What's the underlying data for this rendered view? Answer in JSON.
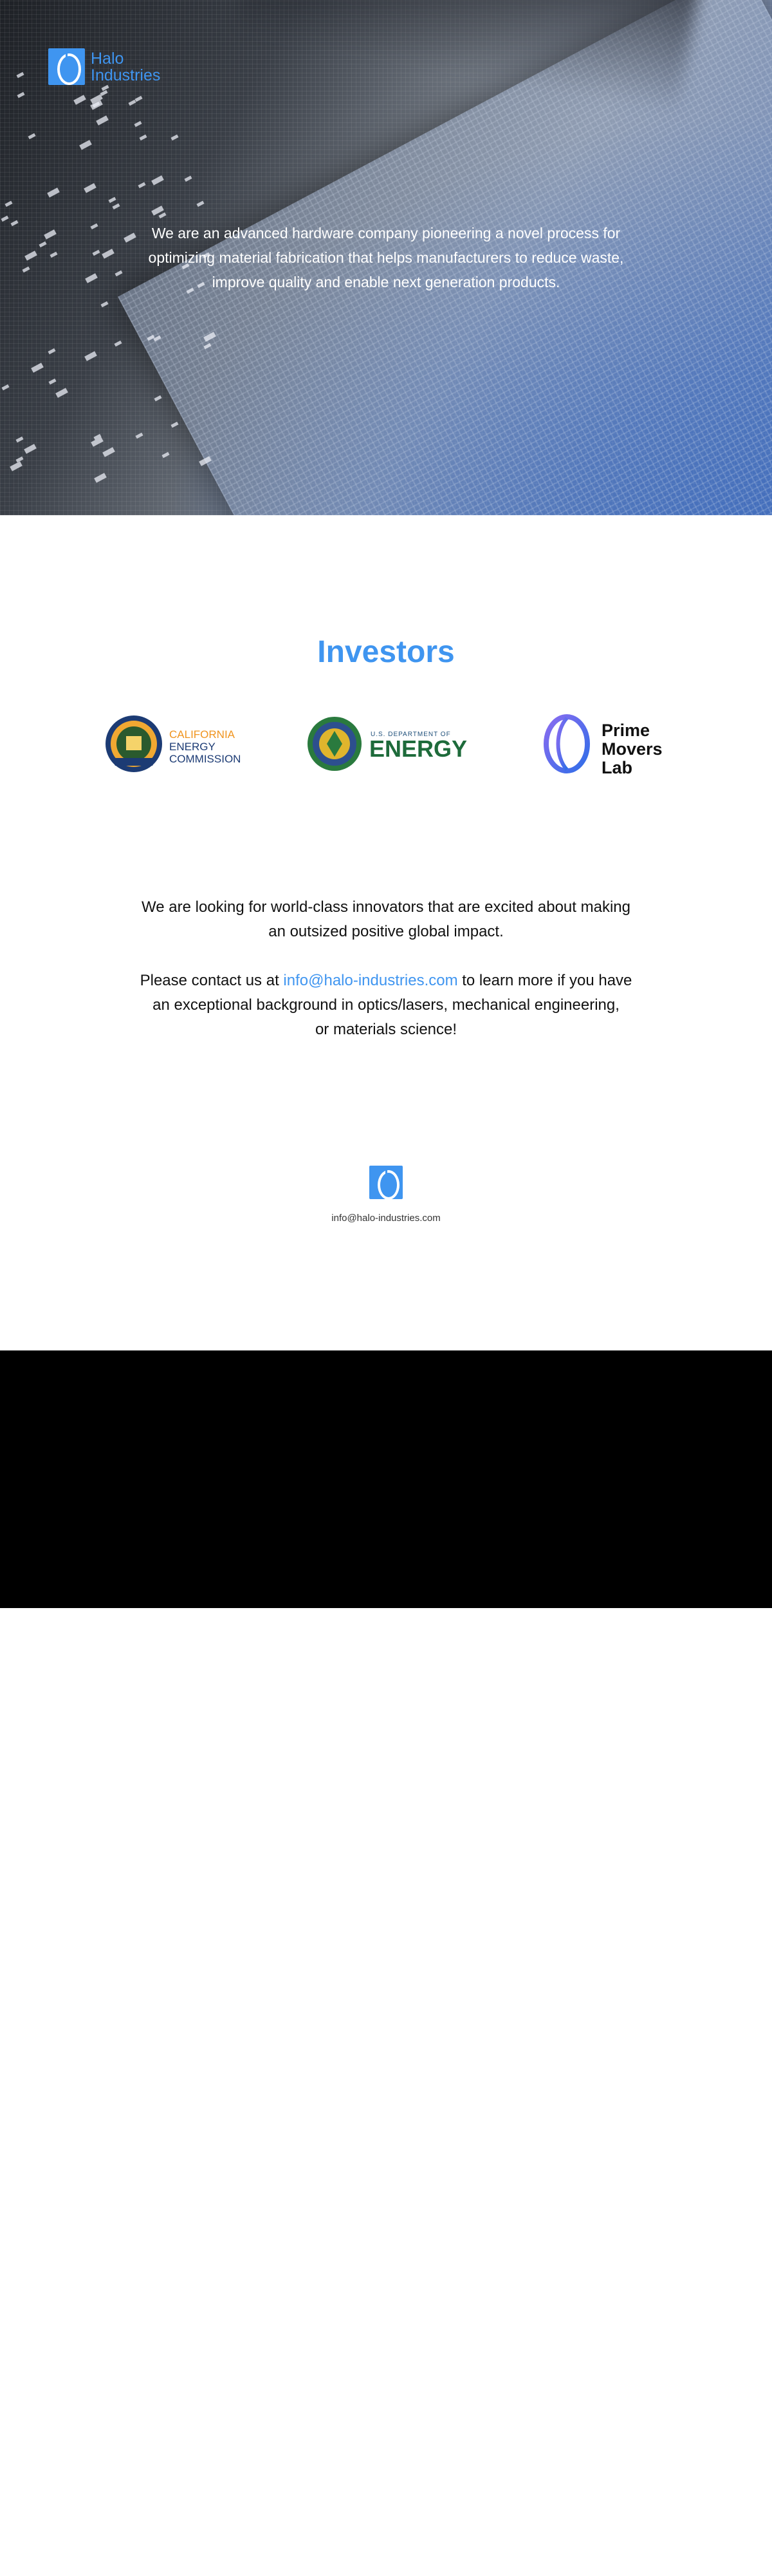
{
  "brand": {
    "name_line1": "Halo",
    "name_line2": "Industries",
    "icon": "halo-logo-icon",
    "color": "#3f95f0"
  },
  "hero": {
    "tagline_line1": "We are an advanced hardware company pioneering a novel process for",
    "tagline_line2": "optimizing material fabrication that helps manufacturers to reduce waste,",
    "tagline_line3": "improve quality and enable next generation products."
  },
  "investors": {
    "title": "Investors",
    "items": [
      {
        "line1": "CALIFORNIA",
        "line2": "ENERGY",
        "line3": "COMMISSION",
        "icon": "california-energy-commission-seal-icon"
      },
      {
        "line1": "U.S. DEPARTMENT OF",
        "line2": "ENERGY",
        "icon": "doe-seal-icon"
      },
      {
        "line1": "Prime",
        "line2": "Movers",
        "line3": "Lab",
        "icon": "prime-movers-lab-logo-icon"
      }
    ]
  },
  "cta": {
    "p1_line1": "We are looking for world-class innovators that are excited about making",
    "p1_line2": "an outsized positive global impact.",
    "p2_before": "Please contact us at",
    "p2_email": "info@halo-industries.com",
    "p2_after": "to learn more if you have",
    "p2_line2": "an exceptional background in optics/lasers, mechanical engineering,",
    "p2_line3": "or materials science!"
  },
  "footer": {
    "email": "info@halo-industries.com",
    "icon": "halo-logo-icon"
  },
  "colors": {
    "accent": "#3f95f0",
    "cec_orange": "#f0941e",
    "cec_navy": "#1c3b74",
    "doe_green": "#1e6b3b"
  }
}
